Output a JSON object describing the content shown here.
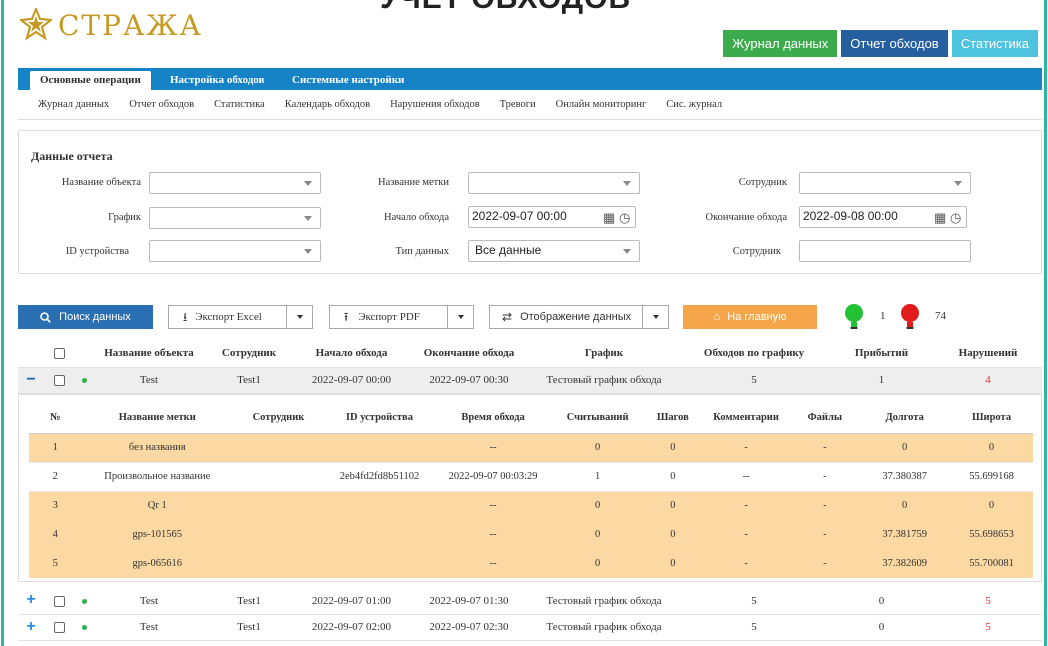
{
  "brand": {
    "name": "СТРАЖА",
    "top_cut_text": "УЧЕТ ОБХОДОВ"
  },
  "colors": {
    "accent": "#1683c7",
    "brand_gold": "#c59b26",
    "highlight_row": "#fcd9a3",
    "violation": "#e0322f"
  },
  "top_buttons": [
    {
      "label": "Журнал данных",
      "color": "#3cab4e"
    },
    {
      "label": "Отчет обходов",
      "color": "#265f9f"
    },
    {
      "label": "Статистика",
      "color": "#4ec3e0"
    }
  ],
  "main_tabs": [
    "Основные операции",
    "Настройка обходов",
    "Системные настройки"
  ],
  "sub_nav": [
    "Журнал данных",
    "Отчет обходов",
    "Статистика",
    "Календарь обходов",
    "Нарушения обходов",
    "Тревоги",
    "Онлайн мониторинг",
    "Сис. журнал"
  ],
  "filter": {
    "title": "Данные отчета",
    "object_name": {
      "label": "Название объекта",
      "value": ""
    },
    "tag_name": {
      "label": "Название метки",
      "value": ""
    },
    "employee": {
      "label": "Сотрудник",
      "value": ""
    },
    "schedule": {
      "label": "График",
      "value": ""
    },
    "start": {
      "label": "Начало обхода",
      "value": "2022-09-07 00:00"
    },
    "end": {
      "label": "Окончание обхода",
      "value": "2022-09-08 00:00"
    },
    "device_id": {
      "label": "ID устройства",
      "value": ""
    },
    "data_type": {
      "label": "Тип данных",
      "value": "Все данные"
    },
    "employee2": {
      "label": "Сотрудник",
      "value": ""
    }
  },
  "actions": {
    "search": "Поиск данных",
    "export_excel": "Экспорт Excel",
    "export_pdf": "Экспорт PDF",
    "display": "Отображение данных",
    "home": "На главную",
    "green_count": "1",
    "red_count": "74"
  },
  "main_table": {
    "headers": [
      "Название объекта",
      "Сотрудник",
      "Начало обхода",
      "Окончание обхода",
      "График",
      "Обходов по графику",
      "Прибытий",
      "Нарушений"
    ],
    "rows": [
      {
        "object": "Test",
        "employee": "Test1",
        "start": "2022-09-07 00:00",
        "end": "2022-09-07 00:30",
        "schedule": "Тестовый график обхода",
        "planned": "5",
        "arrived": "1",
        "violations": "4"
      },
      {
        "object": "Test",
        "employee": "Test1",
        "start": "2022-09-07 01:00",
        "end": "2022-09-07 01:30",
        "schedule": "Тестовый график обхода",
        "planned": "5",
        "arrived": "0",
        "violations": "5"
      },
      {
        "object": "Test",
        "employee": "Test1",
        "start": "2022-09-07 02:00",
        "end": "2022-09-07 02:30",
        "schedule": "Тестовый график обхода",
        "planned": "5",
        "arrived": "0",
        "violations": "5"
      }
    ]
  },
  "sub_table": {
    "headers": [
      "№",
      "Название метки",
      "Сотрудник",
      "ID устройства",
      "Время обхода",
      "Считываний",
      "Шагов",
      "Комментарии",
      "Файлы",
      "Долгота",
      "Широта"
    ],
    "rows": [
      {
        "n": "1",
        "tag": "без названия",
        "employee": "",
        "device": "",
        "time": "--",
        "reads": "0",
        "steps": "0",
        "comment": "-",
        "files": "-",
        "lon": "0",
        "lat": "0"
      },
      {
        "n": "2",
        "tag": "Произвольное название",
        "employee": "",
        "device": "2eb4fd2fd8b51102",
        "time": "2022-09-07 00:03:29",
        "reads": "1",
        "steps": "0",
        "comment": "--",
        "files": "-",
        "lon": "37.380387",
        "lat": "55.699168"
      },
      {
        "n": "3",
        "tag": "Qr 1",
        "employee": "",
        "device": "",
        "time": "--",
        "reads": "0",
        "steps": "0",
        "comment": "-",
        "files": "-",
        "lon": "0",
        "lat": "0"
      },
      {
        "n": "4",
        "tag": "gps-101565",
        "employee": "",
        "device": "",
        "time": "--",
        "reads": "0",
        "steps": "0",
        "comment": "-",
        "files": "-",
        "lon": "37.381759",
        "lat": "55.698653"
      },
      {
        "n": "5",
        "tag": "gps-065616",
        "employee": "",
        "device": "",
        "time": "--",
        "reads": "0",
        "steps": "0",
        "comment": "-",
        "files": "-",
        "lon": "37.382609",
        "lat": "55.700081"
      }
    ]
  }
}
